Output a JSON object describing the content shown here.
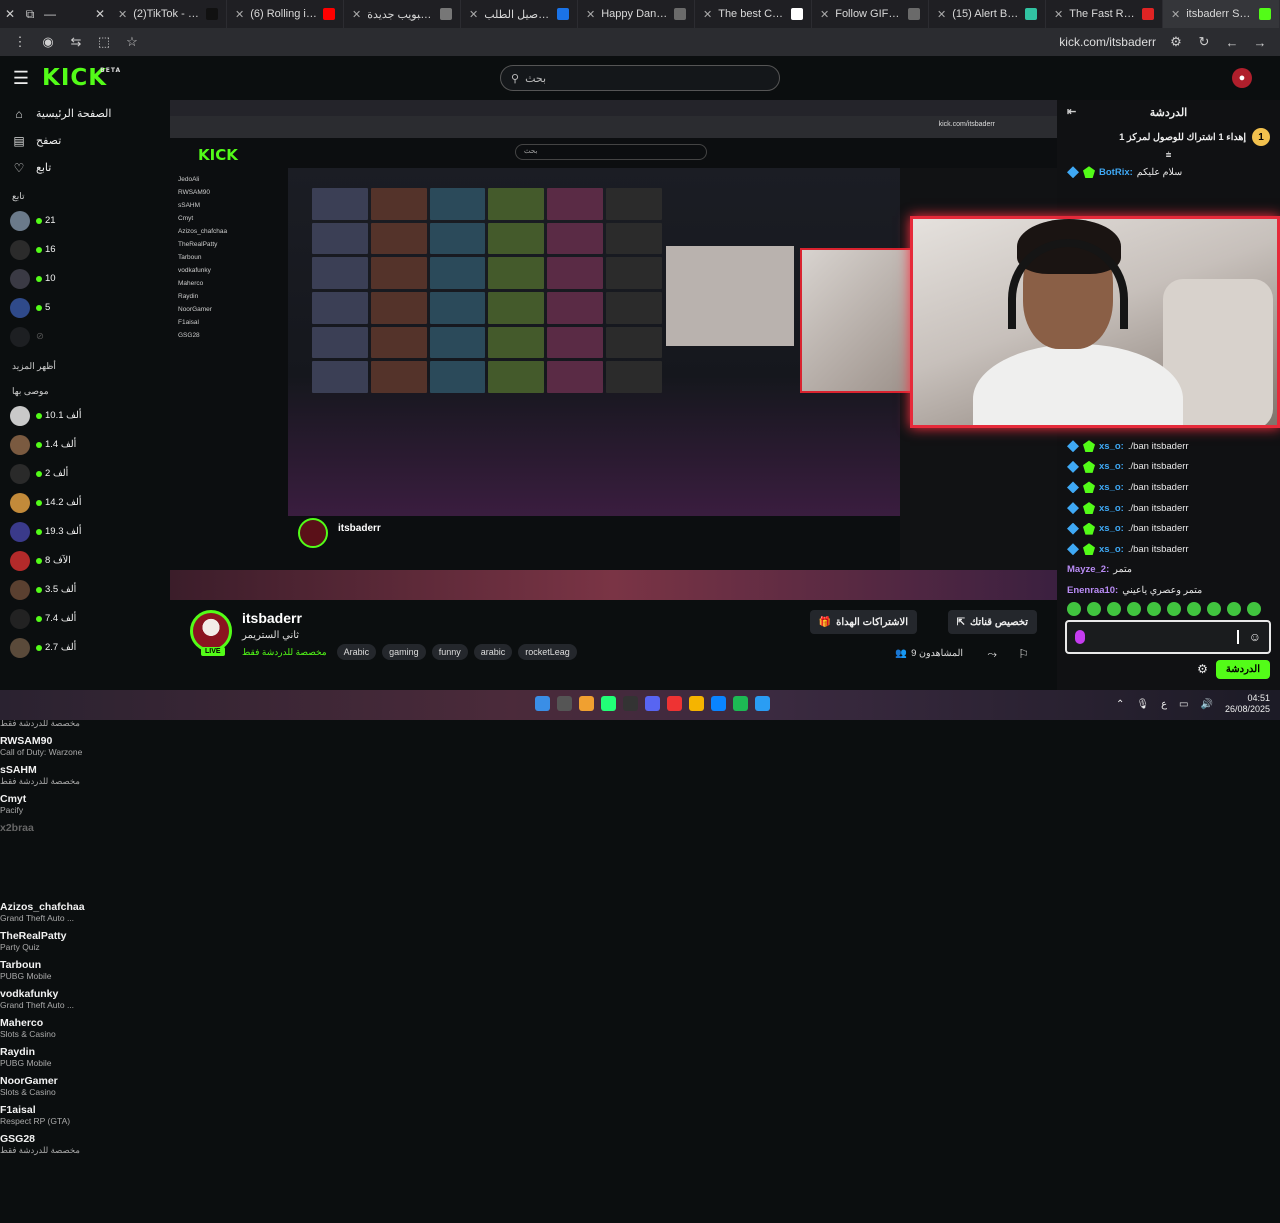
{
  "browser": {
    "tabs": [
      {
        "title": "(2)TikTok - Make",
        "color": "#111111"
      },
      {
        "title": "(6) Rolling in the",
        "color": "#ff0000"
      },
      {
        "title": "علامة تبويب جديدة",
        "color": "#777777"
      },
      {
        "title": "تفاصيل الطلب #",
        "color": "#1a73e8"
      },
      {
        "title": "Happy Dance GIF",
        "color": "#6a6a6a"
      },
      {
        "title": "The best ChatBot",
        "color": "#ffffff"
      },
      {
        "title": "Follow GIFs - Fin",
        "color": "#6a6a6a"
      },
      {
        "title": "(15) Alert Box / S",
        "color": "#31c3a2"
      },
      {
        "title": "The Fast Remote",
        "color": "#e02424"
      },
      {
        "title": "itsbaderr Strea",
        "color": "#53fc18"
      }
    ],
    "url": "kick.com/itsbaderr"
  },
  "header": {
    "logo": "KICK",
    "logo_sup": "BETA",
    "search_placeholder": "بحث"
  },
  "sidebar": {
    "nav": [
      {
        "label": "الصفحة الرئيسية",
        "icon": "home-icon"
      },
      {
        "label": "تصفح",
        "icon": "browse-icon"
      },
      {
        "label": "تابع",
        "icon": "heart-icon"
      }
    ],
    "following_title": "تابع",
    "following": [
      {
        "name": "JedoAli",
        "category": "مخصصة للدردشة فقط",
        "viewers": "21",
        "color": "#6b7a8a"
      },
      {
        "name": "RWSAM90",
        "category": "Call of Duty: Warzone",
        "viewers": "16",
        "color": "#2b2b2b"
      },
      {
        "name": "sSAHM",
        "category": "مخصصة للدردشة فقط",
        "viewers": "10",
        "color": "#3a3a44"
      },
      {
        "name": "Cmyt",
        "category": "Pacify",
        "viewers": "5",
        "color": "#2f4a8a"
      }
    ],
    "offline": "x2braa",
    "show_more": "أظهر المزيد",
    "recommended_title": "موصى بها",
    "recommended": [
      {
        "name": "Azizos_chafchaa",
        "category": "Grand Theft Auto ...",
        "viewers": "10.1 ألف",
        "color": "#c9c9c9"
      },
      {
        "name": "TheRealPatty",
        "category": "Party Quiz",
        "viewers": "1.4 ألف",
        "color": "#7a5a40"
      },
      {
        "name": "Tarboun",
        "category": "PUBG Mobile",
        "viewers": "2 ألف",
        "color": "#2a2a2a"
      },
      {
        "name": "vodkafunky",
        "category": "Grand Theft Auto ...",
        "viewers": "14.2 ألف",
        "color": "#c28a3a"
      },
      {
        "name": "Maherco",
        "category": "Slots & Casino",
        "viewers": "19.3 ألف",
        "color": "#3a3a8a"
      },
      {
        "name": "Raydin",
        "category": "PUBG Mobile",
        "viewers": "8 الآف",
        "color": "#b32a2a"
      },
      {
        "name": "NoorGamer",
        "category": "Slots & Casino",
        "viewers": "3.5 ألف",
        "color": "#5a4030"
      },
      {
        "name": "F1aisal",
        "category": "Respect RP (GTA)",
        "viewers": "7.4 ألف",
        "color": "#222222"
      },
      {
        "name": "GSG28",
        "category": "مخصصة للدردشة فقط",
        "viewers": "2.7 ألف",
        "color": "#5a4a3a"
      }
    ]
  },
  "stream": {
    "name": "itsbaderr",
    "title": "ثاني الستريمر",
    "category": "مخصصة للدردشة فقط",
    "tags": [
      "Arabic",
      "gaming",
      "funny",
      "arabic",
      "rocketLeag"
    ],
    "live": "LIVE",
    "subscribe_btn": "تخصيص قناتك",
    "gift_btn": "الاشتراكات الهداة",
    "viewers": "9 المشاهدون"
  },
  "chat": {
    "title": "الدردشة",
    "pinned": "إهداء 1 اشتراك للوصول لمركز 1",
    "bot_user": "BotRix:",
    "bot_msg": "سلام عليكم",
    "messages": [
      {
        "user": "xs_o:",
        "text": "./ban itsbaderr",
        "color": "#3fa9f5"
      },
      {
        "user": "xs_o:",
        "text": "./ban itsbaderr",
        "color": "#3fa9f5"
      },
      {
        "user": "xs_o:",
        "text": "./ban itsbaderr",
        "color": "#3fa9f5"
      },
      {
        "user": "xs_o:",
        "text": "./ban itsbaderr",
        "color": "#3fa9f5"
      },
      {
        "user": "xs_o:",
        "text": "./ban itsbaderr",
        "color": "#3fa9f5"
      },
      {
        "user": "xs_o:",
        "text": "./ban itsbaderr",
        "color": "#3fa9f5"
      },
      {
        "user": "Mayze_2:",
        "text": "متمر",
        "color": "#b98cf5"
      },
      {
        "user": "Enenraa10:",
        "text": "متمر وعصري ياعيني",
        "color": "#b98cf5"
      }
    ],
    "send": "الدردشة"
  },
  "taskbar": {
    "lang": "ع",
    "time": "04:51",
    "date": "26/08/2025"
  }
}
